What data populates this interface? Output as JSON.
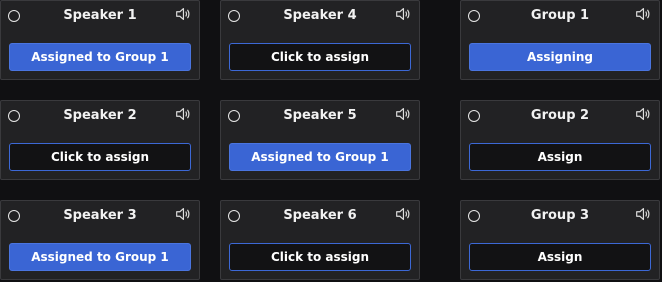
{
  "speakers": [
    {
      "title": "Speaker 1",
      "button": "Assigned to Group 1"
    },
    {
      "title": "Speaker 2",
      "button": "Click to assign"
    },
    {
      "title": "Speaker 3",
      "button": "Assigned to Group 1"
    },
    {
      "title": "Speaker 4",
      "button": "Click to assign"
    },
    {
      "title": "Speaker 5",
      "button": "Assigned to Group 1"
    },
    {
      "title": "Speaker 6",
      "button": "Click to assign"
    }
  ],
  "groups": [
    {
      "title": "Group 1",
      "button": "Assigning"
    },
    {
      "title": "Group 2",
      "button": "Assign"
    },
    {
      "title": "Group 3",
      "button": "Assign"
    }
  ],
  "colors": {
    "accent": "#3a65d4",
    "card_bg": "#222224",
    "page_bg": "#101012"
  },
  "icons": {
    "card_icon": "speaker-volume-icon",
    "selector": "radio-circle"
  }
}
